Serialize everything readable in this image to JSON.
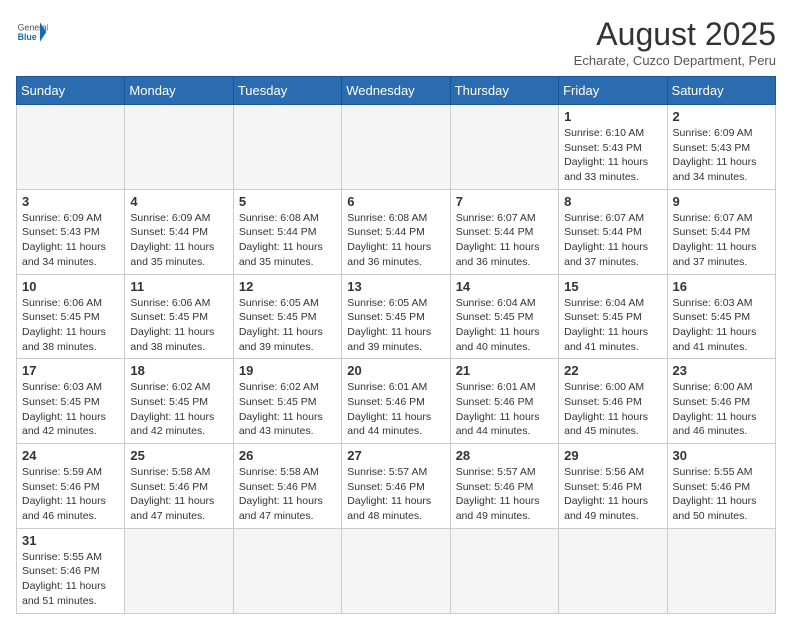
{
  "header": {
    "logo_general": "General",
    "logo_blue": "Blue",
    "month_title": "August 2025",
    "subtitle": "Echarate, Cuzco Department, Peru"
  },
  "weekdays": [
    "Sunday",
    "Monday",
    "Tuesday",
    "Wednesday",
    "Thursday",
    "Friday",
    "Saturday"
  ],
  "weeks": [
    [
      {
        "day": "",
        "detail": ""
      },
      {
        "day": "",
        "detail": ""
      },
      {
        "day": "",
        "detail": ""
      },
      {
        "day": "",
        "detail": ""
      },
      {
        "day": "",
        "detail": ""
      },
      {
        "day": "1",
        "detail": "Sunrise: 6:10 AM\nSunset: 5:43 PM\nDaylight: 11 hours\nand 33 minutes."
      },
      {
        "day": "2",
        "detail": "Sunrise: 6:09 AM\nSunset: 5:43 PM\nDaylight: 11 hours\nand 34 minutes."
      }
    ],
    [
      {
        "day": "3",
        "detail": "Sunrise: 6:09 AM\nSunset: 5:43 PM\nDaylight: 11 hours\nand 34 minutes."
      },
      {
        "day": "4",
        "detail": "Sunrise: 6:09 AM\nSunset: 5:44 PM\nDaylight: 11 hours\nand 35 minutes."
      },
      {
        "day": "5",
        "detail": "Sunrise: 6:08 AM\nSunset: 5:44 PM\nDaylight: 11 hours\nand 35 minutes."
      },
      {
        "day": "6",
        "detail": "Sunrise: 6:08 AM\nSunset: 5:44 PM\nDaylight: 11 hours\nand 36 minutes."
      },
      {
        "day": "7",
        "detail": "Sunrise: 6:07 AM\nSunset: 5:44 PM\nDaylight: 11 hours\nand 36 minutes."
      },
      {
        "day": "8",
        "detail": "Sunrise: 6:07 AM\nSunset: 5:44 PM\nDaylight: 11 hours\nand 37 minutes."
      },
      {
        "day": "9",
        "detail": "Sunrise: 6:07 AM\nSunset: 5:44 PM\nDaylight: 11 hours\nand 37 minutes."
      }
    ],
    [
      {
        "day": "10",
        "detail": "Sunrise: 6:06 AM\nSunset: 5:45 PM\nDaylight: 11 hours\nand 38 minutes."
      },
      {
        "day": "11",
        "detail": "Sunrise: 6:06 AM\nSunset: 5:45 PM\nDaylight: 11 hours\nand 38 minutes."
      },
      {
        "day": "12",
        "detail": "Sunrise: 6:05 AM\nSunset: 5:45 PM\nDaylight: 11 hours\nand 39 minutes."
      },
      {
        "day": "13",
        "detail": "Sunrise: 6:05 AM\nSunset: 5:45 PM\nDaylight: 11 hours\nand 39 minutes."
      },
      {
        "day": "14",
        "detail": "Sunrise: 6:04 AM\nSunset: 5:45 PM\nDaylight: 11 hours\nand 40 minutes."
      },
      {
        "day": "15",
        "detail": "Sunrise: 6:04 AM\nSunset: 5:45 PM\nDaylight: 11 hours\nand 41 minutes."
      },
      {
        "day": "16",
        "detail": "Sunrise: 6:03 AM\nSunset: 5:45 PM\nDaylight: 11 hours\nand 41 minutes."
      }
    ],
    [
      {
        "day": "17",
        "detail": "Sunrise: 6:03 AM\nSunset: 5:45 PM\nDaylight: 11 hours\nand 42 minutes."
      },
      {
        "day": "18",
        "detail": "Sunrise: 6:02 AM\nSunset: 5:45 PM\nDaylight: 11 hours\nand 42 minutes."
      },
      {
        "day": "19",
        "detail": "Sunrise: 6:02 AM\nSunset: 5:45 PM\nDaylight: 11 hours\nand 43 minutes."
      },
      {
        "day": "20",
        "detail": "Sunrise: 6:01 AM\nSunset: 5:46 PM\nDaylight: 11 hours\nand 44 minutes."
      },
      {
        "day": "21",
        "detail": "Sunrise: 6:01 AM\nSunset: 5:46 PM\nDaylight: 11 hours\nand 44 minutes."
      },
      {
        "day": "22",
        "detail": "Sunrise: 6:00 AM\nSunset: 5:46 PM\nDaylight: 11 hours\nand 45 minutes."
      },
      {
        "day": "23",
        "detail": "Sunrise: 6:00 AM\nSunset: 5:46 PM\nDaylight: 11 hours\nand 46 minutes."
      }
    ],
    [
      {
        "day": "24",
        "detail": "Sunrise: 5:59 AM\nSunset: 5:46 PM\nDaylight: 11 hours\nand 46 minutes."
      },
      {
        "day": "25",
        "detail": "Sunrise: 5:58 AM\nSunset: 5:46 PM\nDaylight: 11 hours\nand 47 minutes."
      },
      {
        "day": "26",
        "detail": "Sunrise: 5:58 AM\nSunset: 5:46 PM\nDaylight: 11 hours\nand 47 minutes."
      },
      {
        "day": "27",
        "detail": "Sunrise: 5:57 AM\nSunset: 5:46 PM\nDaylight: 11 hours\nand 48 minutes."
      },
      {
        "day": "28",
        "detail": "Sunrise: 5:57 AM\nSunset: 5:46 PM\nDaylight: 11 hours\nand 49 minutes."
      },
      {
        "day": "29",
        "detail": "Sunrise: 5:56 AM\nSunset: 5:46 PM\nDaylight: 11 hours\nand 49 minutes."
      },
      {
        "day": "30",
        "detail": "Sunrise: 5:55 AM\nSunset: 5:46 PM\nDaylight: 11 hours\nand 50 minutes."
      }
    ],
    [
      {
        "day": "31",
        "detail": "Sunrise: 5:55 AM\nSunset: 5:46 PM\nDaylight: 11 hours\nand 51 minutes."
      },
      {
        "day": "",
        "detail": ""
      },
      {
        "day": "",
        "detail": ""
      },
      {
        "day": "",
        "detail": ""
      },
      {
        "day": "",
        "detail": ""
      },
      {
        "day": "",
        "detail": ""
      },
      {
        "day": "",
        "detail": ""
      }
    ]
  ]
}
